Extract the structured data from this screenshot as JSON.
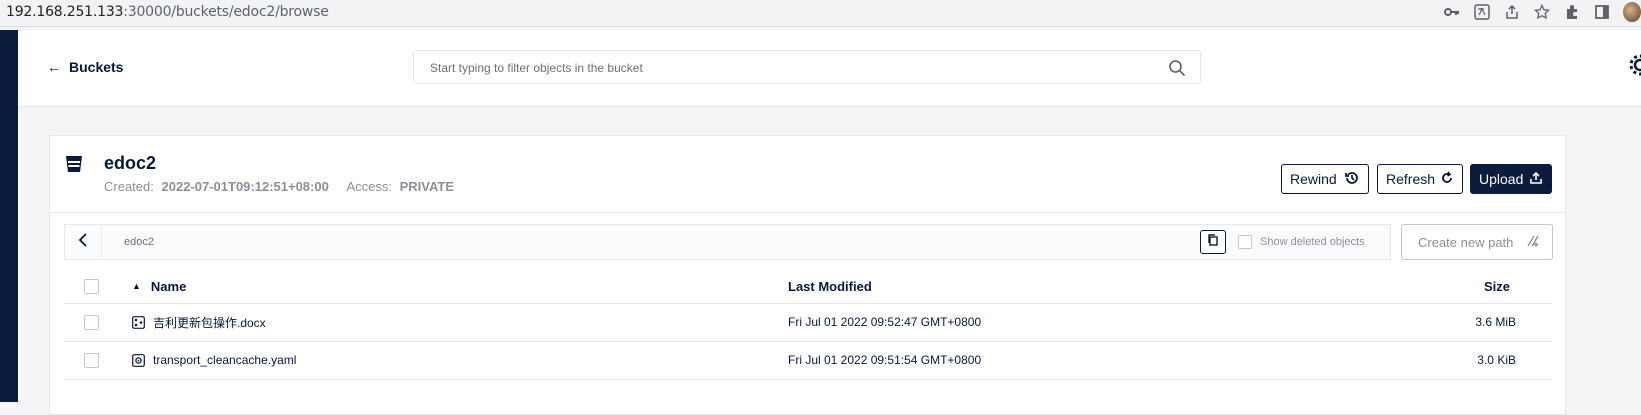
{
  "browser": {
    "url_host": "192.168.251.133",
    "url_path": ":30000/buckets/edoc2/browse"
  },
  "header": {
    "back_label": "Buckets",
    "search_placeholder": "Start typing to filter objects in the bucket"
  },
  "bucket": {
    "name": "edoc2",
    "created_label": "Created:",
    "created_value": "2022-07-01T09:12:51+08:00",
    "access_label": "Access:",
    "access_value": "PRIVATE"
  },
  "actions": {
    "rewind": "Rewind",
    "refresh": "Refresh",
    "upload": "Upload"
  },
  "pathbar": {
    "path": "edoc2",
    "show_deleted_label": "Show deleted objects",
    "create_path_label": "Create new path"
  },
  "table": {
    "columns": {
      "name": "Name",
      "last_modified": "Last Modified",
      "size": "Size"
    },
    "rows": [
      {
        "name": "吉利更新包操作.docx",
        "modified": "Fri Jul 01 2022 09:52:47 GMT+0800",
        "size": "3.6 MiB",
        "icon": "document-icon"
      },
      {
        "name": "transport_cleancache.yaml",
        "modified": "Fri Jul 01 2022 09:51:54 GMT+0800",
        "size": "3.0 KiB",
        "icon": "config-file-icon"
      }
    ]
  },
  "colors": {
    "primary": "#0b1c3e",
    "muted": "#8a8f98",
    "border": "#e5e7eb"
  }
}
